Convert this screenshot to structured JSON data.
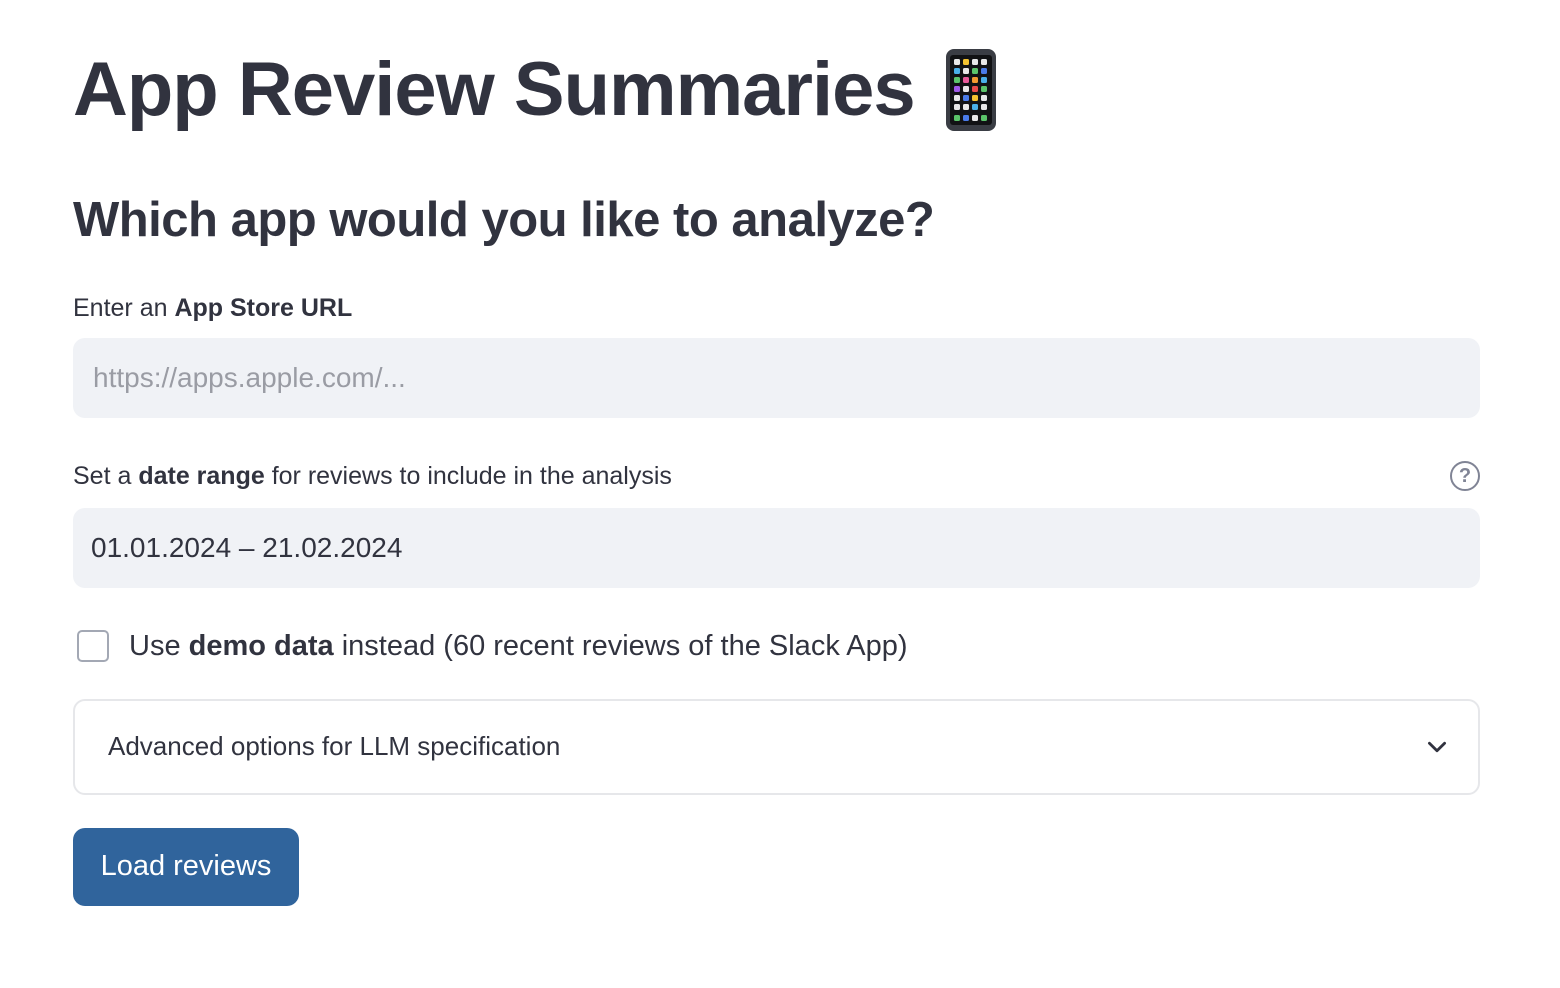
{
  "header": {
    "title": "App Review Summaries",
    "title_icon": "mobile-phone-icon"
  },
  "main": {
    "subtitle": "Which app would you like to analyze?",
    "url_field": {
      "label_prefix": "Enter an ",
      "label_bold": "App Store URL",
      "placeholder": "https://apps.apple.com/...",
      "value": ""
    },
    "date_field": {
      "label_prefix": "Set a ",
      "label_bold": "date range",
      "label_suffix": " for reviews to include in the analysis",
      "help_icon": "question-circle-icon",
      "help_glyph": "?",
      "value": "01.01.2024 – 21.02.2024"
    },
    "demo_checkbox": {
      "checked": false,
      "label_prefix": "Use ",
      "label_bold": "demo data",
      "label_suffix": " instead (60 recent reviews of the Slack App)"
    },
    "advanced_expander": {
      "label": "Advanced options for LLM specification",
      "icon": "chevron-down-icon",
      "expanded": false
    },
    "load_button": {
      "label": "Load reviews",
      "color": "#30649c"
    }
  },
  "colors": {
    "text": "#31333f",
    "input_bg": "#f0f2f6",
    "placeholder": "#9a9ca4",
    "border": "#e6e7ea"
  }
}
